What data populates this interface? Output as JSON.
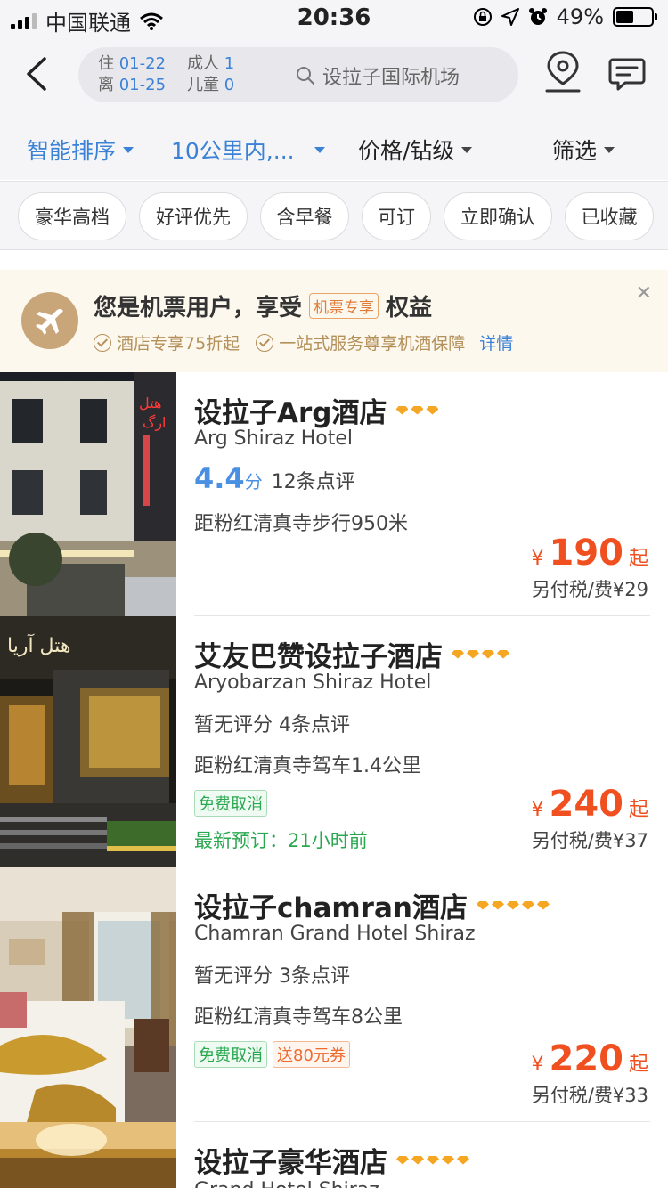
{
  "status_bar": {
    "carrier": "中国联通",
    "time": "20:36",
    "battery": "49%",
    "battery_level": 0.49
  },
  "header": {
    "checkin_label": "住",
    "checkin_date": "01-22",
    "checkout_label": "离",
    "checkout_date": "01-25",
    "adults_label": "成人",
    "adults_count": "1",
    "children_label": "儿童",
    "children_count": "0",
    "search_placeholder": "设拉子国际机场"
  },
  "sort_bar": {
    "smart_sort": "智能排序",
    "distance": "10公里内,...",
    "price_level": "价格/钻级",
    "filter": "筛选"
  },
  "quick_filters": [
    "豪华高档",
    "好评优先",
    "含早餐",
    "可订",
    "立即确认",
    "已收藏"
  ],
  "promo": {
    "title_prefix": "您是机票用户，享受",
    "badge": "机票专享",
    "title_suffix": "权益",
    "benefit_1": "酒店专享75折起",
    "benefit_2": "一站式服务尊享机酒保障",
    "detail": "详情",
    "close": "✕"
  },
  "hotels": [
    {
      "name": "设拉子Arg酒店",
      "diamonds": 3,
      "name_en": "Arg Shiraz Hotel",
      "score": "4.4",
      "score_unit": "分",
      "reviews": "12条点评",
      "distance": "距粉红清真寺步行950米",
      "currency": "¥",
      "price": "190",
      "price_suffix": "起",
      "tax": "另付税/费¥29"
    },
    {
      "name": "艾友巴赞设拉子酒店",
      "diamonds": 4,
      "name_en": "Aryobarzan Shiraz Hotel",
      "rating_text": "暂无评分",
      "reviews": "4条点评",
      "distance": "距粉红清真寺驾车1.4公里",
      "tag_1": "免费取消",
      "recent": "最新预订：21小时前",
      "currency": "¥",
      "price": "240",
      "price_suffix": "起",
      "tax": "另付税/费¥37"
    },
    {
      "name": "设拉子chamran酒店",
      "diamonds": 5,
      "name_en": "Chamran Grand Hotel Shiraz",
      "rating_text": "暂无评分",
      "reviews": "3条点评",
      "distance": "距粉红清真寺驾车8公里",
      "tag_1": "免费取消",
      "tag_2": "送80元券",
      "currency": "¥",
      "price": "220",
      "price_suffix": "起",
      "tax": "另付税/费¥33"
    },
    {
      "name": "设拉子豪华酒店",
      "diamonds": 5,
      "name_en": "Grand Hotel Shiraz"
    }
  ]
}
